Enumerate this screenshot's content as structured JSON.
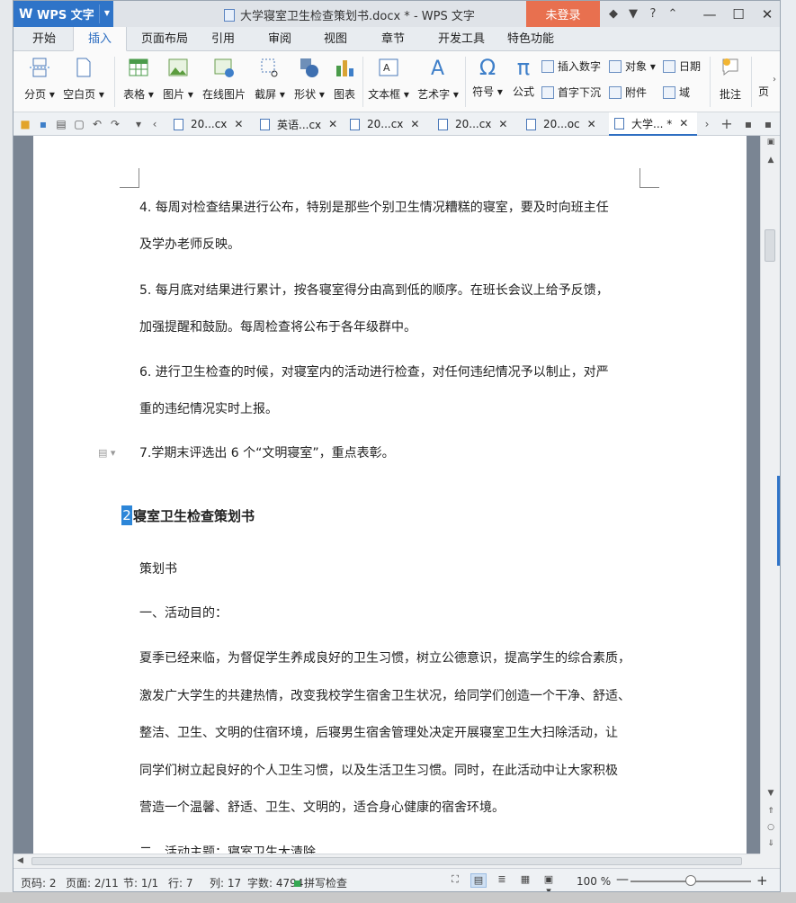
{
  "app": {
    "name": "WPS 文字",
    "window_title": "大学寝室卫生检查策划书.docx * - WPS 文字",
    "login_label": "未登录",
    "help_label": "?"
  },
  "tabs": [
    "开始",
    "插入",
    "页面布局",
    "引用",
    "审阅",
    "视图",
    "章节",
    "开发工具",
    "特色功能"
  ],
  "active_tab_index": 1,
  "ribbon": {
    "page_break": "分页",
    "blank_page": "空白页",
    "table": "表格",
    "picture": "图片",
    "online_picture": "在线图片",
    "screenshot": "截屏",
    "shape": "形状",
    "chart": "图表",
    "textbox": "文本框",
    "wordart": "艺术字",
    "symbol": "符号",
    "formula": "公式",
    "insert_number": "插入数字",
    "drop_cap": "首字下沉",
    "object": "对象",
    "attachment": "附件",
    "date": "日期",
    "field": "域",
    "comment": "批注",
    "page": "页"
  },
  "doc_tabs": [
    {
      "label": "20...cx"
    },
    {
      "label": "英语...cx"
    },
    {
      "label": "20...cx"
    },
    {
      "label": "20...cx"
    },
    {
      "label": "20...oc"
    },
    {
      "label": "大学... *"
    }
  ],
  "document": {
    "lines": [
      "4. 每周对检查结果进行公布，特别是那些个别卫生情况糟糕的寝室，要及时向班主任",
      "及学办老师反映。",
      "5. 每月底对结果进行累计，按各寝室得分由高到低的顺序。在班长会议上给予反馈，",
      "加强提醒和鼓励。每周检查将公布于各年级群中。",
      "6. 进行卫生检查的时候，对寝室内的活动进行检查，对任何违纪情况予以制止，对严",
      "重的违纪情况实时上报。",
      "7.学期末评选出 6 个“文明寝室”，重点表彰。"
    ],
    "heading_number": "2",
    "heading": "寝室卫生检查策划书",
    "sub_lines": [
      "策划书",
      "一、活动目的：",
      "夏季已经来临，为督促学生养成良好的卫生习惯，树立公德意识，提高学生的综合素质，",
      "激发广大学生的共建热情，改变我校学生宿舍卫生状况，给同学们创造一个干净、舒适、",
      "整洁、卫生、文明的住宿环境，后寝男生宿舍管理处决定开展寝室卫生大扫除活动，让",
      "同学们树立起良好的个人卫生习惯，以及生活卫生习惯。同时，在此活动中让大家积极",
      "营造一个温馨、舒适、卫生、文明的，适合身心健康的宿舍环境。",
      "二、活动主题：寝室卫生大清除"
    ]
  },
  "status": {
    "page_num": "页码: 2",
    "pages": "页面: 2/11",
    "section": "节: 1/1",
    "row": "行: 7",
    "col": "列: 17",
    "words": "字数: 4794",
    "spell": "拼写检查",
    "zoom": "100 %",
    "zoom_value": 100
  },
  "colors": {
    "brand": "#2f74c8",
    "login": "#e8704f",
    "accent_tab": "#2f6fc2"
  }
}
